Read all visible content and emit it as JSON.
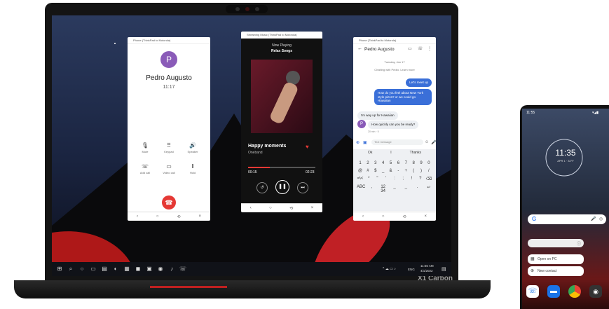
{
  "laptop": {
    "brand": "X1 Carbon"
  },
  "call_window": {
    "title": "Phone (ThinkPad to Motorola)",
    "avatar_letter": "P",
    "caller_name": "Pedro Augusto",
    "call_time": "11:17",
    "controls": [
      "Mute",
      "Keypad",
      "Speaker",
      "Add call",
      "Video call",
      "Hold"
    ],
    "avatar_color": "#8a5bb8",
    "hangup_color": "#e53935"
  },
  "music_window": {
    "title": "Streaming Music (ThinkPad to Motorola)",
    "header": "Now Playing",
    "playlist": "Relax Songs",
    "song_title": "Happy moments",
    "artist": "Oneband",
    "time_elapsed": "00:15",
    "time_total": "02:23",
    "progress": 0.32,
    "accent": "#e53935"
  },
  "chat_window": {
    "title": "Phone (ThinkPad to Motorola)",
    "contact": "Pedro Augusto",
    "date": "Tuesday, Jan 17",
    "chat_status": "Chatting with Pedro. Learn more",
    "messages": [
      {
        "text": "Let's meet up",
        "out": true
      },
      {
        "text": "How do you feel about New York style pizza? or we could go Hawaiian",
        "out": true
      },
      {
        "text": "I'm way up for Hawaiian",
        "out": false
      },
      {
        "text": "How quickly can you be ready?",
        "out": false
      }
    ],
    "msg_meta": "20 min · 5",
    "input_placeholder": "Text message",
    "suggestions": [
      "Ok",
      "I",
      "Thanks"
    ],
    "keyboard_rows": [
      [
        "1",
        "2",
        "3",
        "4",
        "5",
        "6",
        "7",
        "8",
        "9",
        "0"
      ],
      [
        "@",
        "#",
        "$",
        "_",
        "&",
        "-",
        "+",
        "(",
        ")",
        "/"
      ],
      [
        "=\\<",
        "*",
        "\"",
        "'",
        ":",
        ";",
        "!",
        "?",
        "⌫"
      ],
      [
        "ABC",
        ",",
        "12\n34",
        "_",
        "_",
        ".",
        "↵"
      ]
    ],
    "bubble_color": "#3a6fd8"
  },
  "taskbar": {
    "time": "11:55 AM",
    "date": "4/1/2022",
    "lang": "ENG"
  },
  "phone": {
    "status_time": "11:55",
    "clock": "11:35",
    "clock_date": "APR 1 · 32°F",
    "search_logo": "G",
    "open_on_pc": "Open on PC",
    "new_contact": "New contact"
  }
}
